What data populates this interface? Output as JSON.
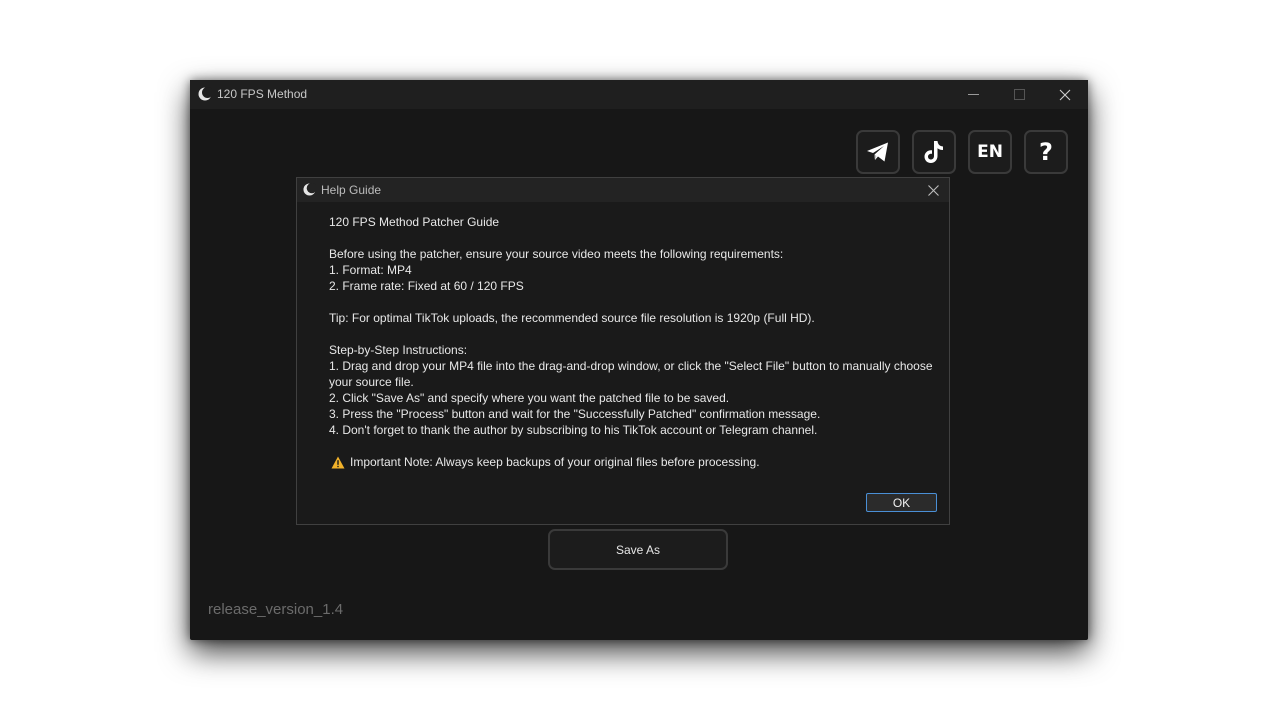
{
  "window": {
    "title": "120 FPS Method"
  },
  "toolbar": {
    "telegram_icon": "telegram-icon",
    "tiktok_icon": "tiktok-icon",
    "language_label": "EN",
    "help_label": "?"
  },
  "main": {
    "save_as_label": "Save As",
    "version_label": "release_version_1.4"
  },
  "dialog": {
    "title": "Help Guide",
    "heading": "120 FPS Method Patcher Guide",
    "requirements_intro": "Before using the patcher, ensure your source video meets the following requirements:",
    "requirements": [
      "1. Format: MP4",
      "2. Frame rate: Fixed at 60 / 120 FPS"
    ],
    "tip": "Tip: For optimal TikTok uploads, the recommended source file resolution is 1920p (Full HD).",
    "steps_heading": "Step-by-Step Instructions:",
    "steps": [
      "1. Drag and drop your MP4 file into the drag-and-drop window, or click the \"Select File\" button to manually choose your source file.",
      "2. Click \"Save As\" and specify where you want the patched file to be saved.",
      "3. Press the \"Process\" button and wait for the \"Successfully Patched\" confirmation message.",
      "4. Don't forget to thank the author by subscribing to his TikTok account or Telegram channel."
    ],
    "note": "Important Note: Always keep backups of your original files before processing.",
    "ok_label": "OK"
  },
  "colors": {
    "window_bg": "#171717",
    "button_border": "#3a3a3a",
    "ok_border": "#4a8fd6",
    "warning": "#f2b22a"
  }
}
